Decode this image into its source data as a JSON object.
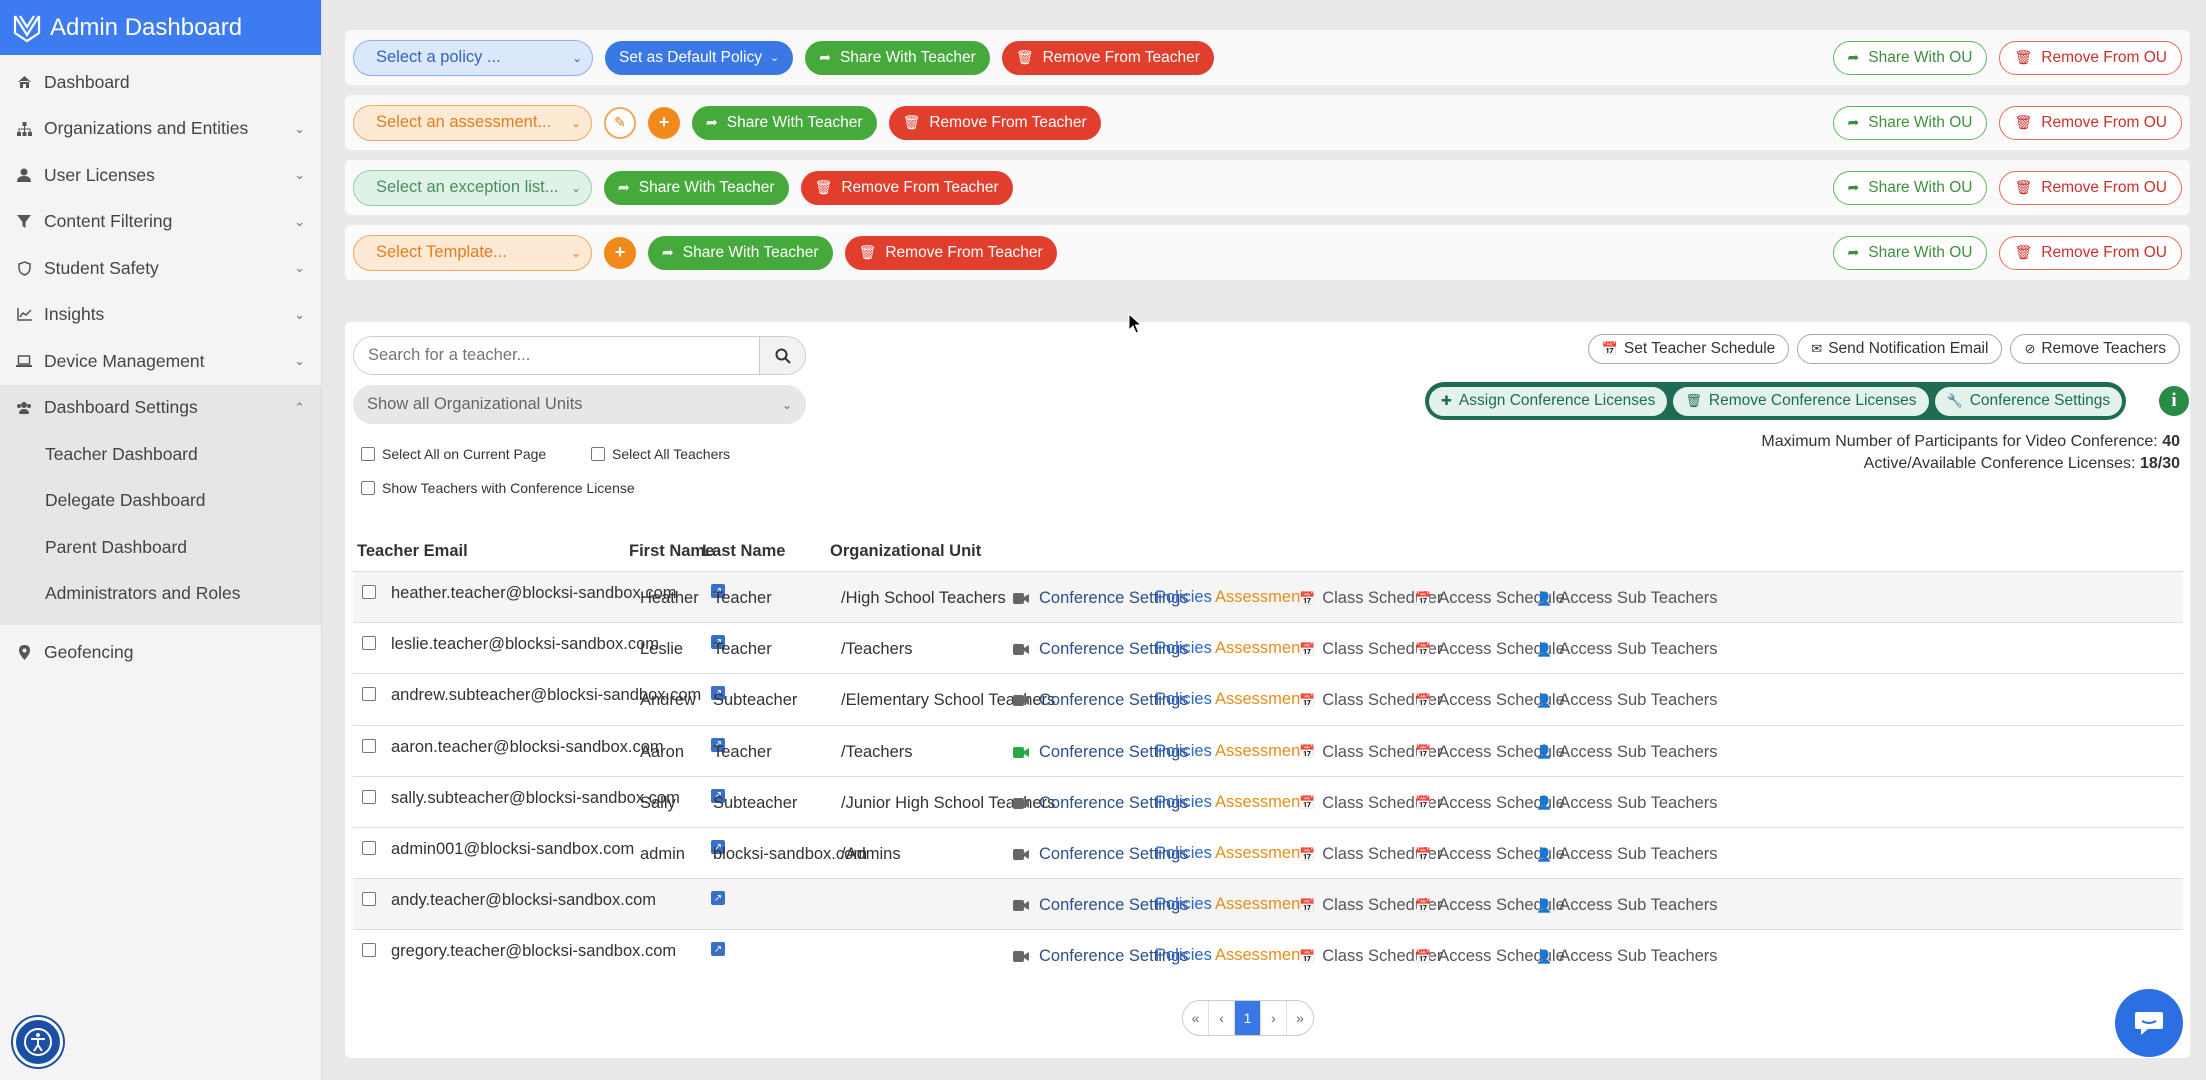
{
  "sidebar": {
    "brand": "Admin Dashboard",
    "items": [
      {
        "label": "Dashboard",
        "icon": "home-icon"
      },
      {
        "label": "Organizations and Entities",
        "icon": "sitemap-icon"
      },
      {
        "label": "User Licenses",
        "icon": "user-icon"
      },
      {
        "label": "Content Filtering",
        "icon": "filter-icon"
      },
      {
        "label": "Student Safety",
        "icon": "shield-icon"
      },
      {
        "label": "Insights",
        "icon": "chart-icon"
      },
      {
        "label": "Device Management",
        "icon": "laptop-icon"
      },
      {
        "label": "Dashboard Settings",
        "icon": "users-icon"
      }
    ],
    "subitems": [
      "Teacher Dashboard",
      "Delegate Dashboard",
      "Parent Dashboard",
      "Administrators and Roles"
    ],
    "geofencing": "Geofencing"
  },
  "bars": {
    "policy": {
      "select": "Select a policy ...",
      "default": "Set as Default Policy",
      "share": "Share With Teacher",
      "remove": "Remove From Teacher",
      "share_ou": "Share With OU",
      "remove_ou": "Remove From OU"
    },
    "assessment": {
      "select": "Select an assessment...",
      "share": "Share With Teacher",
      "remove": "Remove From Teacher",
      "share_ou": "Share With OU",
      "remove_ou": "Remove From OU"
    },
    "exception": {
      "select": "Select an exception list...",
      "share": "Share With Teacher",
      "remove": "Remove From Teacher",
      "share_ou": "Share With OU",
      "remove_ou": "Remove From OU"
    },
    "template": {
      "select": "Select Template...",
      "share": "Share With Teacher",
      "remove": "Remove From Teacher",
      "share_ou": "Share With OU",
      "remove_ou": "Remove From OU"
    }
  },
  "panel": {
    "search_placeholder": "Search for a teacher...",
    "ou_select": "Show all Organizational Units",
    "select_all_page": "Select All on Current Page",
    "select_all_teachers": "Select All Teachers",
    "show_conf": "Show Teachers with Conference License",
    "set_schedule": "Set Teacher Schedule",
    "send_email": "Send Notification Email",
    "remove_teachers": "Remove Teachers",
    "assign_conf": "Assign Conference Licenses",
    "remove_conf": "Remove Conference Licenses",
    "conf_settings": "Conference Settings",
    "max_label": "Maximum Number of Participants for Video Conference:",
    "max_value": "40",
    "active_label": "Active/Available Conference Licenses:",
    "active_value": "18/30"
  },
  "table": {
    "headers": [
      "Teacher Email",
      "First Name",
      "Last Name",
      "Organizational Unit"
    ],
    "link_labels": {
      "conf": "Conference Settings",
      "policies": "Policies",
      "assessments": "Assessments",
      "class": "Class Scheduler",
      "access": "Access Schedule",
      "sub": "Access Sub Teachers"
    },
    "rows": [
      {
        "email": "heather.teacher@blocksi-sandbox.com",
        "first": "Heather",
        "last": "Teacher",
        "ou": "/High School Teachers",
        "conf_active": false
      },
      {
        "email": "leslie.teacher@blocksi-sandbox.com",
        "first": "Leslie",
        "last": "Teacher",
        "ou": "/Teachers",
        "conf_active": false
      },
      {
        "email": "andrew.subteacher@blocksi-sandbox.com",
        "first": "Andrew",
        "last": "Subteacher",
        "ou": "/Elementary School Teachers",
        "conf_active": false
      },
      {
        "email": "aaron.teacher@blocksi-sandbox.com",
        "first": "Aaron",
        "last": "Teacher",
        "ou": "/Teachers",
        "conf_active": true
      },
      {
        "email": "sally.subteacher@blocksi-sandbox.com",
        "first": "Sally",
        "last": "Subteacher",
        "ou": "/Junior High School Teachers",
        "conf_active": false
      },
      {
        "email": "admin001@blocksi-sandbox.com",
        "first": "admin",
        "last": "blocksi-sandbox.com",
        "ou": "/Admins",
        "conf_active": false
      },
      {
        "email": "andy.teacher@blocksi-sandbox.com",
        "first": "",
        "last": "",
        "ou": "",
        "conf_active": false
      },
      {
        "email": "gregory.teacher@blocksi-sandbox.com",
        "first": "",
        "last": "",
        "ou": "",
        "conf_active": false
      }
    ]
  },
  "pager": {
    "first": "«",
    "prev": "‹",
    "current": "1",
    "next": "›",
    "last": "»"
  }
}
